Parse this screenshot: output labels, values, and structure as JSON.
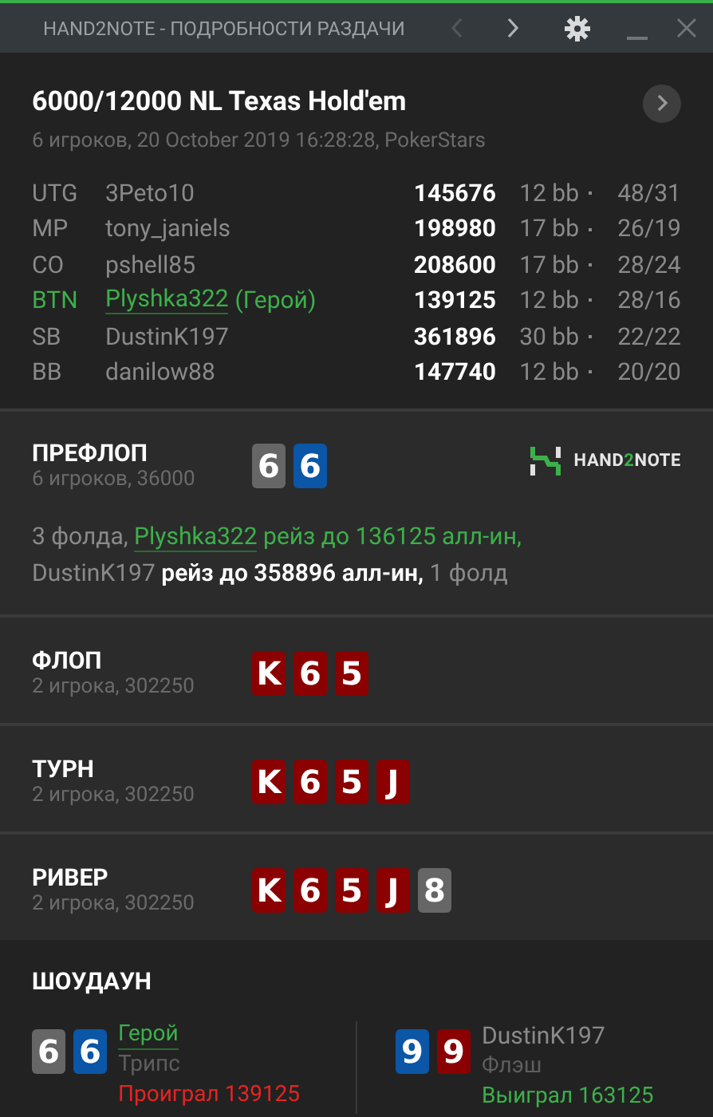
{
  "window": {
    "title": "HAND2NOTE - ПОДРОБНОСТИ РАЗДАЧИ"
  },
  "hand": {
    "title": "6000/12000 NL Texas Hold'em",
    "subtitle": "6 игроков, 20 October 2019 16:28:28, PokerStars"
  },
  "players": [
    {
      "position": "UTG",
      "name": "3Peto10",
      "hero": false,
      "stack": "145676",
      "bb": "12 bb",
      "stats": "48/31"
    },
    {
      "position": "MP",
      "name": "tony_janiels",
      "hero": false,
      "stack": "198980",
      "bb": "17 bb",
      "stats": "26/19"
    },
    {
      "position": "CO",
      "name": "pshell85",
      "hero": false,
      "stack": "208600",
      "bb": "17 bb",
      "stats": "28/24"
    },
    {
      "position": "BTN",
      "name": "Plyshka322",
      "hero": true,
      "hero_label": "(Герой)",
      "stack": "139125",
      "bb": "12 bb",
      "stats": "28/16"
    },
    {
      "position": "SB",
      "name": "DustinK197",
      "hero": false,
      "stack": "361896",
      "bb": "30 bb",
      "stats": "22/22"
    },
    {
      "position": "BB",
      "name": "danilow88",
      "hero": false,
      "stack": "147740",
      "bb": "12 bb",
      "stats": "20/20"
    }
  ],
  "streets": [
    {
      "name": "ПРЕФЛОП",
      "info": "6 игроков, 36000",
      "cards": [
        {
          "rank": "6",
          "color": "#666666"
        },
        {
          "rank": "6",
          "color": "#0b56a6"
        }
      ],
      "action": [
        {
          "kind": "plain",
          "text": "3 фолда, "
        },
        {
          "kind": "hero_link",
          "text": "Plyshka322"
        },
        {
          "kind": "hero",
          "text": " рейз до 136125 алл-ин,"
        },
        {
          "kind": "break"
        },
        {
          "kind": "plain",
          "text": "DustinK197"
        },
        {
          "kind": "strong",
          "text": " рейз до 358896 алл-ин,"
        },
        {
          "kind": "plain",
          "text": " 1 фолд"
        }
      ]
    },
    {
      "name": "ФЛОП",
      "info": "2 игрока, 302250",
      "cards": [
        {
          "rank": "K",
          "color": "#8b0000"
        },
        {
          "rank": "6",
          "color": "#8b0000"
        },
        {
          "rank": "5",
          "color": "#8b0000"
        }
      ]
    },
    {
      "name": "ТУРН",
      "info": "2 игрока, 302250",
      "cards": [
        {
          "rank": "K",
          "color": "#8b0000"
        },
        {
          "rank": "6",
          "color": "#8b0000"
        },
        {
          "rank": "5",
          "color": "#8b0000"
        },
        {
          "rank": "J",
          "color": "#8b0000"
        }
      ]
    },
    {
      "name": "РИВЕР",
      "info": "2 игрока, 302250",
      "cards": [
        {
          "rank": "K",
          "color": "#8b0000"
        },
        {
          "rank": "6",
          "color": "#8b0000"
        },
        {
          "rank": "5",
          "color": "#8b0000"
        },
        {
          "rank": "J",
          "color": "#8b0000"
        },
        {
          "rank": "8",
          "color": "#666666"
        }
      ]
    }
  ],
  "logo": {
    "text_a": "HAND",
    "text_b": "2",
    "text_c": "NOTE"
  },
  "showdown": {
    "title": "ШОУДАУН",
    "hands": [
      {
        "player": "Герой",
        "hero": true,
        "combo": "Трипс",
        "result": "Проиграл 139125",
        "won": false,
        "cards": [
          {
            "rank": "6",
            "color": "#666666"
          },
          {
            "rank": "6",
            "color": "#0b56a6"
          }
        ]
      },
      {
        "player": "DustinK197",
        "hero": false,
        "combo": "Флэш",
        "result": "Выиграл 163125",
        "won": true,
        "cards": [
          {
            "rank": "9",
            "color": "#0b56a6"
          },
          {
            "rank": "9",
            "color": "#8b0000"
          }
        ]
      }
    ]
  }
}
